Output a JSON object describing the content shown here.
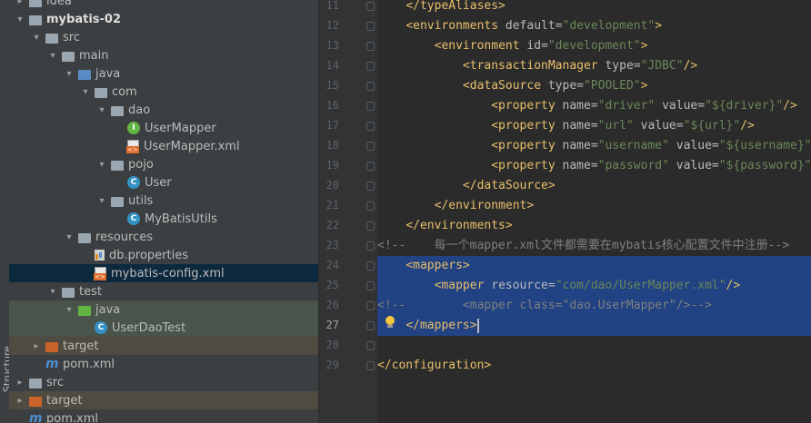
{
  "sidebar": {
    "structure_label": "Structure"
  },
  "tree": [
    {
      "label": "idea",
      "icon": "folder-icon",
      "depth": 1,
      "arrow": "collapsed"
    },
    {
      "label": "mybatis-02",
      "icon": "module-folder-icon",
      "depth": 1,
      "arrow": "expanded",
      "bold": true
    },
    {
      "label": "src",
      "icon": "folder-icon",
      "depth": 2,
      "arrow": "expanded"
    },
    {
      "label": "main",
      "icon": "folder-icon",
      "depth": 3,
      "arrow": "expanded"
    },
    {
      "label": "java",
      "icon": "source-folder-icon",
      "depth": 4,
      "arrow": "expanded"
    },
    {
      "label": "com",
      "icon": "package-icon",
      "depth": 5,
      "arrow": "expanded"
    },
    {
      "label": "dao",
      "icon": "package-icon",
      "depth": 6,
      "arrow": "expanded"
    },
    {
      "label": "UserMapper",
      "icon": "interface-icon",
      "depth": 7,
      "arrow": "none"
    },
    {
      "label": "UserMapper.xml",
      "icon": "xml-file-icon",
      "depth": 7,
      "arrow": "none"
    },
    {
      "label": "pojo",
      "icon": "package-icon",
      "depth": 6,
      "arrow": "expanded"
    },
    {
      "label": "User",
      "icon": "class-icon",
      "depth": 7,
      "arrow": "none"
    },
    {
      "label": "utils",
      "icon": "package-icon",
      "depth": 6,
      "arrow": "expanded"
    },
    {
      "label": "MyBatisUtils",
      "icon": "class-icon",
      "depth": 7,
      "arrow": "none"
    },
    {
      "label": "resources",
      "icon": "resources-folder-icon",
      "depth": 4,
      "arrow": "expanded"
    },
    {
      "label": "db.properties",
      "icon": "properties-file-icon",
      "depth": 5,
      "arrow": "none"
    },
    {
      "label": "mybatis-config.xml",
      "icon": "xml-file-icon",
      "depth": 5,
      "arrow": "none",
      "selected": true
    },
    {
      "label": "test",
      "icon": "folder-icon",
      "depth": 3,
      "arrow": "expanded"
    },
    {
      "label": "java",
      "icon": "test-folder-icon",
      "depth": 4,
      "arrow": "expanded",
      "test": true
    },
    {
      "label": "UserDaoTest",
      "icon": "test-class-icon",
      "depth": 5,
      "arrow": "none",
      "test": true
    },
    {
      "label": "target",
      "icon": "excluded-folder-icon",
      "depth": 2,
      "arrow": "collapsed",
      "excluded": true
    },
    {
      "label": "pom.xml",
      "icon": "maven-icon",
      "depth": 2,
      "arrow": "none"
    },
    {
      "label": "src",
      "icon": "folder-icon",
      "depth": 1,
      "arrow": "collapsed"
    },
    {
      "label": "target",
      "icon": "excluded-folder-icon",
      "depth": 1,
      "arrow": "collapsed",
      "excluded": true
    },
    {
      "label": "pom.xml",
      "icon": "maven-icon",
      "depth": 1,
      "arrow": "none"
    }
  ],
  "editor": {
    "lines": [
      {
        "no": "11",
        "indent": "    ",
        "parts": [
          [
            "t",
            "</typeAliases>"
          ]
        ]
      },
      {
        "no": "12",
        "indent": "    ",
        "parts": [
          [
            "t",
            "<environments "
          ],
          [
            "a",
            "default="
          ],
          [
            "v",
            "\"development\""
          ],
          [
            "t",
            ">"
          ]
        ]
      },
      {
        "no": "13",
        "indent": "        ",
        "parts": [
          [
            "t",
            "<environment "
          ],
          [
            "a",
            "id="
          ],
          [
            "v",
            "\"development\""
          ],
          [
            "t",
            ">"
          ]
        ]
      },
      {
        "no": "14",
        "indent": "            ",
        "parts": [
          [
            "t",
            "<transactionManager "
          ],
          [
            "a",
            "type="
          ],
          [
            "v",
            "\"JDBC\""
          ],
          [
            "t",
            "/>"
          ]
        ]
      },
      {
        "no": "15",
        "indent": "            ",
        "parts": [
          [
            "t",
            "<dataSource "
          ],
          [
            "a",
            "type="
          ],
          [
            "v",
            "\"POOLED\""
          ],
          [
            "t",
            ">"
          ]
        ]
      },
      {
        "no": "16",
        "indent": "                ",
        "parts": [
          [
            "t",
            "<property "
          ],
          [
            "a",
            "name="
          ],
          [
            "v",
            "\"driver\""
          ],
          [
            "a",
            " value="
          ],
          [
            "v",
            "\"${driver}\""
          ],
          [
            "t",
            "/>"
          ]
        ]
      },
      {
        "no": "17",
        "indent": "                ",
        "parts": [
          [
            "t",
            "<property "
          ],
          [
            "a",
            "name="
          ],
          [
            "v",
            "\"url\""
          ],
          [
            "a",
            " value="
          ],
          [
            "v",
            "\"${url}\""
          ],
          [
            "t",
            "/>"
          ]
        ]
      },
      {
        "no": "18",
        "indent": "                ",
        "parts": [
          [
            "t",
            "<property "
          ],
          [
            "a",
            "name="
          ],
          [
            "v",
            "\"username\""
          ],
          [
            "a",
            " value="
          ],
          [
            "v",
            "\"${username}\""
          ],
          [
            "t",
            "/>"
          ]
        ]
      },
      {
        "no": "19",
        "indent": "                ",
        "parts": [
          [
            "t",
            "<property "
          ],
          [
            "a",
            "name="
          ],
          [
            "v",
            "\"password\""
          ],
          [
            "a",
            " value="
          ],
          [
            "v",
            "\"${password}\""
          ],
          [
            "t",
            "/>"
          ]
        ]
      },
      {
        "no": "20",
        "indent": "            ",
        "parts": [
          [
            "t",
            "</dataSource>"
          ]
        ]
      },
      {
        "no": "21",
        "indent": "        ",
        "parts": [
          [
            "t",
            "</environment>"
          ]
        ]
      },
      {
        "no": "22",
        "indent": "    ",
        "parts": [
          [
            "t",
            "</environments>"
          ]
        ]
      },
      {
        "no": "23",
        "indent": "",
        "parts": [
          [
            "c",
            "<!--    每一个mapper.xml文件都需要在mybatis核心配置文件中注册-->"
          ]
        ]
      },
      {
        "no": "24",
        "indent": "    ",
        "parts": [
          [
            "t",
            "<mappers>"
          ]
        ],
        "selected": true
      },
      {
        "no": "25",
        "indent": "        ",
        "parts": [
          [
            "t",
            "<mapper "
          ],
          [
            "a",
            "resource="
          ],
          [
            "v",
            "\"com/dao/UserMapper.xml\""
          ],
          [
            "t",
            "/>"
          ]
        ],
        "selected": true
      },
      {
        "no": "26",
        "indent": "",
        "parts": [
          [
            "c",
            "<!--        <mapper class=\"dao.UserMapper\"/>-->"
          ]
        ],
        "selected": true
      },
      {
        "no": "27",
        "indent": "    ",
        "parts": [
          [
            "t",
            "</mappers>"
          ]
        ],
        "selected": true,
        "current": true
      },
      {
        "no": "28",
        "indent": "",
        "parts": []
      },
      {
        "no": "29",
        "indent": "",
        "parts": [
          [
            "t",
            "</configuration>"
          ]
        ]
      }
    ]
  },
  "colors": {
    "tag": "#e8bf6a",
    "attribute": "#bababa",
    "string": "#6a8759",
    "comment": "#808080",
    "selection": "#214283"
  }
}
